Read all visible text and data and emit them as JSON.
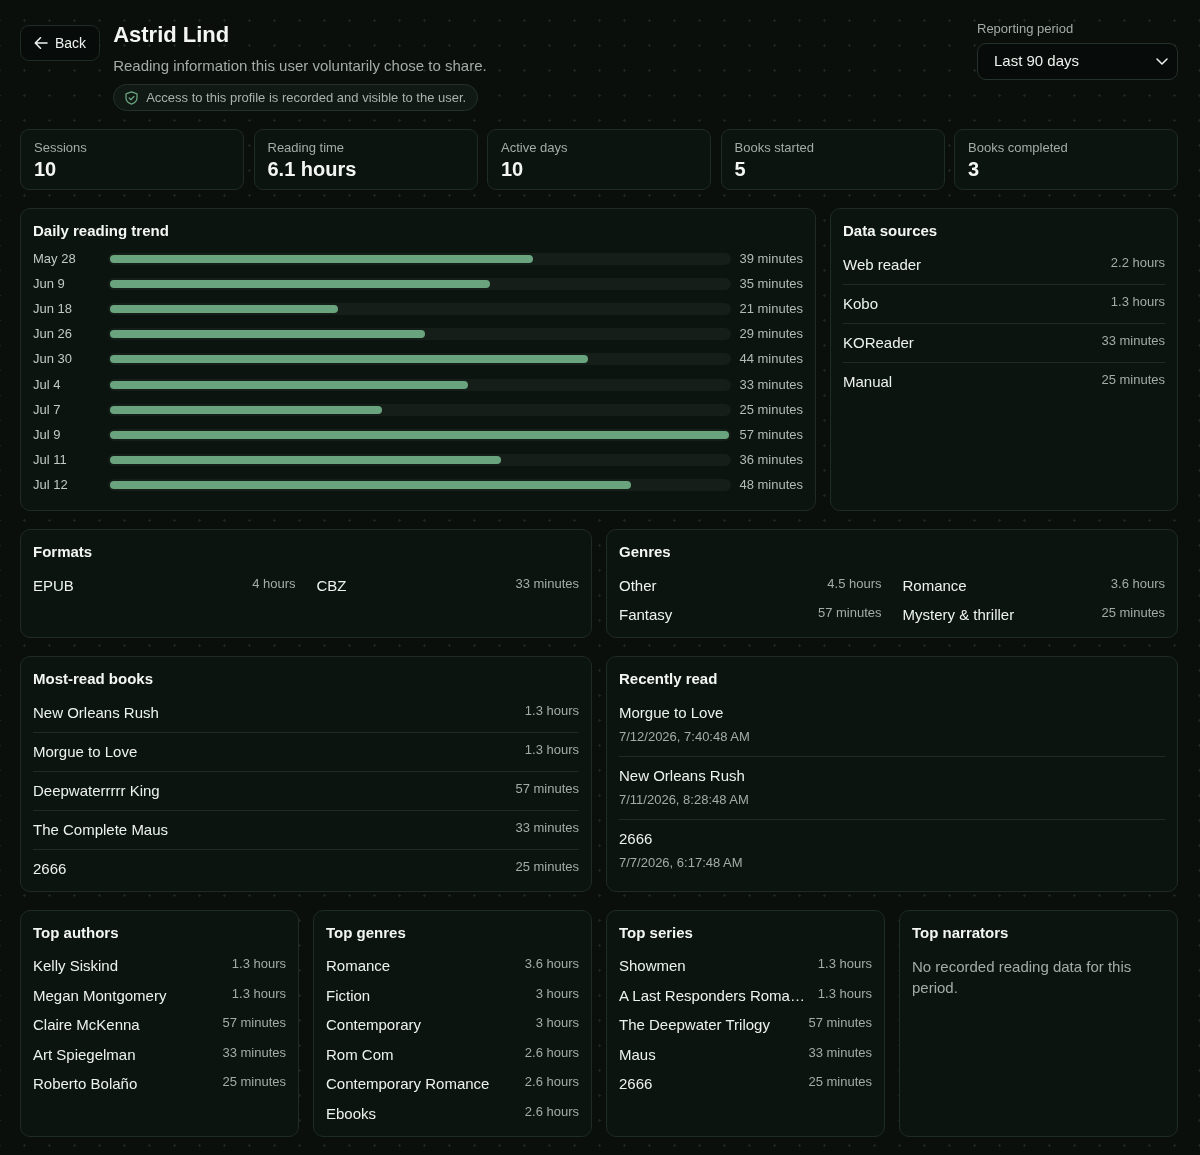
{
  "header": {
    "back_button": "Back",
    "title": "Astrid Lind",
    "subtitle": "Reading information this user voluntarily chose to share.",
    "notice": "Access to this profile is recorded and visible to the user."
  },
  "period": {
    "label": "Reporting period",
    "value": "Last 90 days"
  },
  "stats": [
    {
      "label": "Sessions",
      "value": "10"
    },
    {
      "label": "Reading time",
      "value": "6.1 hours"
    },
    {
      "label": "Active days",
      "value": "10"
    },
    {
      "label": "Books started",
      "value": "5"
    },
    {
      "label": "Books completed",
      "value": "3"
    }
  ],
  "daily_trend": {
    "title": "Daily reading trend",
    "rows": [
      {
        "date": "May 28",
        "level": 0.684,
        "reading": "39 minutes"
      },
      {
        "date": "Jun 9",
        "level": 0.614,
        "reading": "35 minutes"
      },
      {
        "date": "Jun 18",
        "level": 0.368,
        "reading": "21 minutes"
      },
      {
        "date": "Jun 26",
        "level": 0.509,
        "reading": "29 minutes"
      },
      {
        "date": "Jun 30",
        "level": 0.772,
        "reading": "44 minutes"
      },
      {
        "date": "Jul 4",
        "level": 0.579,
        "reading": "33 minutes"
      },
      {
        "date": "Jul 7",
        "level": 0.439,
        "reading": "25 minutes"
      },
      {
        "date": "Jul 9",
        "level": 1,
        "reading": "57 minutes"
      },
      {
        "date": "Jul 11",
        "level": 0.632,
        "reading": "36 minutes"
      },
      {
        "date": "Jul 12",
        "level": 0.842,
        "reading": "48 minutes"
      }
    ]
  },
  "data_sources": {
    "title": "Data sources",
    "rows": [
      {
        "name": "Web reader",
        "value": "2.2 hours"
      },
      {
        "name": "Kobo",
        "value": "1.3 hours"
      },
      {
        "name": "KOReader",
        "value": "33 minutes"
      },
      {
        "name": "Manual",
        "value": "25 minutes"
      }
    ]
  },
  "formats": {
    "title": "Formats",
    "items": [
      {
        "name": "EPUB",
        "value": "4 hours"
      },
      {
        "name": "CBZ",
        "value": "33 minutes"
      }
    ]
  },
  "genres": {
    "title": "Genres",
    "items": [
      {
        "name": "Other",
        "value": "4.5 hours"
      },
      {
        "name": "Romance",
        "value": "3.6 hours"
      },
      {
        "name": "Fantasy",
        "value": "57 minutes"
      },
      {
        "name": "Mystery & thriller",
        "value": "25 minutes"
      }
    ]
  },
  "most_read_books": {
    "title": "Most-read books",
    "rows": [
      {
        "name": "New Orleans Rush",
        "value": "1.3 hours"
      },
      {
        "name": "Morgue to Love",
        "value": "1.3 hours"
      },
      {
        "name": "Deepwaterrrrr King",
        "value": "57 minutes"
      },
      {
        "name": "The Complete Maus",
        "value": "33 minutes"
      },
      {
        "name": "2666",
        "value": "25 minutes"
      }
    ]
  },
  "recently_read": {
    "title": "Recently read",
    "items": [
      {
        "title": "Morgue to Love",
        "time": "7/12/2026, 7:40:48 AM"
      },
      {
        "title": "New Orleans Rush",
        "time": "7/11/2026, 8:28:48 AM"
      },
      {
        "title": "2666",
        "time": "7/7/2026, 6:17:48 AM"
      }
    ]
  },
  "top_lists": [
    {
      "title": "Top authors",
      "rows": [
        {
          "name": "Kelly Siskind",
          "value": "1.3 hours"
        },
        {
          "name": "Megan Montgomery",
          "value": "1.3 hours"
        },
        {
          "name": "Claire McKenna",
          "value": "57 minutes"
        },
        {
          "name": "Art Spiegelman",
          "value": "33 minutes"
        },
        {
          "name": "Roberto Bolaño",
          "value": "25 minutes"
        }
      ]
    },
    {
      "title": "Top genres",
      "rows": [
        {
          "name": "Romance",
          "value": "3.6 hours"
        },
        {
          "name": "Fiction",
          "value": "3 hours"
        },
        {
          "name": "Contemporary",
          "value": "3 hours"
        },
        {
          "name": "Rom Com",
          "value": "2.6 hours"
        },
        {
          "name": "Contemporary Romance",
          "value": "2.6 hours"
        },
        {
          "name": "Ebooks",
          "value": "2.6 hours"
        }
      ]
    },
    {
      "title": "Top series",
      "rows": [
        {
          "name": "Showmen",
          "value": "1.3 hours"
        },
        {
          "name": "A Last Responders Roma…",
          "value": "1.3 hours"
        },
        {
          "name": "The Deepwater Trilogy",
          "value": "57 minutes"
        },
        {
          "name": "Maus",
          "value": "33 minutes"
        },
        {
          "name": "2666",
          "value": "25 minutes"
        }
      ]
    },
    {
      "title": "Top narrators",
      "empty_message": "No recorded reading data for this period."
    }
  ]
}
